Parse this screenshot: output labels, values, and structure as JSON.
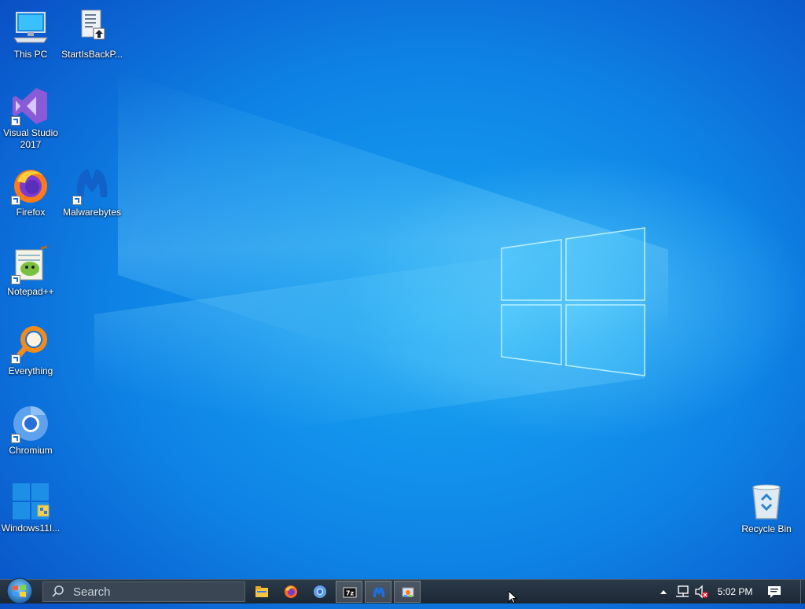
{
  "desktop": {
    "icons": [
      {
        "label": "This PC"
      },
      {
        "label": "StartIsBackP..."
      },
      {
        "label": "Visual Studio 2017"
      },
      {
        "label": "Firefox"
      },
      {
        "label": "Malwarebytes"
      },
      {
        "label": "Notepad++"
      },
      {
        "label": "Everything"
      },
      {
        "label": "Chromium"
      },
      {
        "label": "Windows11I..."
      },
      {
        "label": "Recycle Bin"
      }
    ]
  },
  "taskbar": {
    "search_placeholder": "Search",
    "pinned": [
      {
        "icon": "file-explorer-icon"
      },
      {
        "icon": "firefox-icon"
      },
      {
        "icon": "chromium-icon"
      },
      {
        "icon": "7zip-icon"
      },
      {
        "icon": "malwarebytes-icon"
      },
      {
        "icon": "control-panel-icon"
      }
    ],
    "tray": {
      "time": "5:02 PM"
    }
  },
  "colors": {
    "wallpaper_blue": "#0e84e6",
    "taskbar": "#1c2733"
  }
}
